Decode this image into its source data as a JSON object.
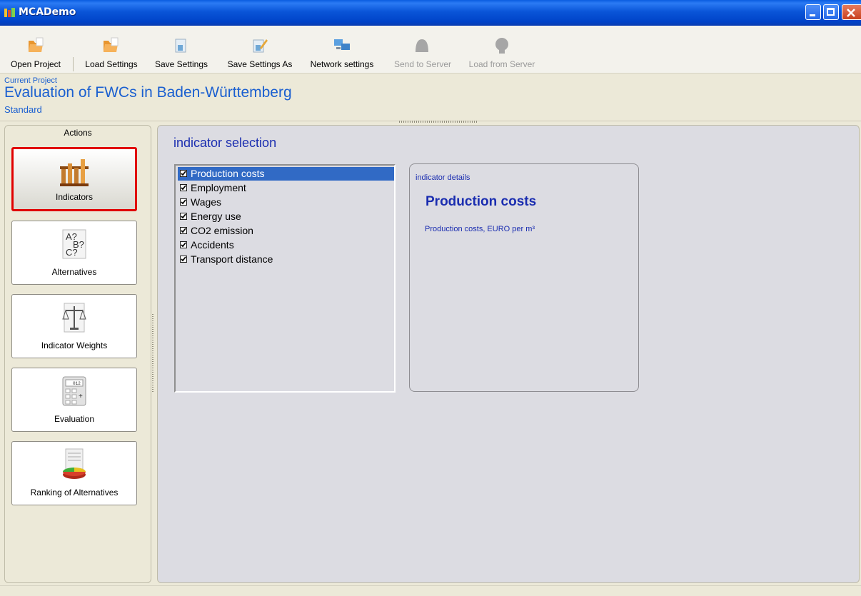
{
  "window": {
    "title": "MCADemo"
  },
  "toolbar": {
    "items": [
      {
        "label": "Open Project",
        "icon": "folder-icon",
        "enabled": true
      },
      {
        "label": "Load Settings",
        "icon": "folder-icon",
        "enabled": true
      },
      {
        "label": "Save Settings",
        "icon": "save-icon",
        "enabled": true
      },
      {
        "label": "Save Settings As",
        "icon": "save-as-icon",
        "enabled": true
      },
      {
        "label": "Network settings",
        "icon": "network-icon",
        "enabled": true
      },
      {
        "label": "Send to Server",
        "icon": "server-upload-icon",
        "enabled": false
      },
      {
        "label": "Load from Server",
        "icon": "server-download-icon",
        "enabled": false
      }
    ]
  },
  "project": {
    "caption": "Current Project",
    "title": "Evaluation of FWCs in Baden-Württemberg",
    "subtitle": "Standard"
  },
  "actions": {
    "title": "Actions",
    "items": [
      {
        "label": "Indicators",
        "icon": "indicators-icon",
        "selected": true
      },
      {
        "label": "Alternatives",
        "icon": "alternatives-icon",
        "selected": false
      },
      {
        "label": "Indicator Weights",
        "icon": "scales-icon",
        "selected": false
      },
      {
        "label": "Evaluation",
        "icon": "calculator-icon",
        "selected": false
      },
      {
        "label": "Ranking of Alternatives",
        "icon": "pie-chart-icon",
        "selected": false
      }
    ]
  },
  "indicator_selection": {
    "title": "indicator selection",
    "items": [
      {
        "label": "Production costs",
        "checked": true,
        "selected": true
      },
      {
        "label": "Employment",
        "checked": true,
        "selected": false
      },
      {
        "label": "Wages",
        "checked": true,
        "selected": false
      },
      {
        "label": "Energy use",
        "checked": true,
        "selected": false
      },
      {
        "label": "CO2 emission",
        "checked": true,
        "selected": false
      },
      {
        "label": "Accidents",
        "checked": true,
        "selected": false
      },
      {
        "label": "Transport distance",
        "checked": true,
        "selected": false
      }
    ]
  },
  "indicator_details": {
    "caption": "indicator details",
    "name": "Production costs",
    "description": "Production costs, EURO per m³"
  },
  "colors": {
    "accent": "#1A2DB0",
    "selection": "#316AC5",
    "selected_border": "#E10000",
    "titlebar": "#0A55D8"
  }
}
